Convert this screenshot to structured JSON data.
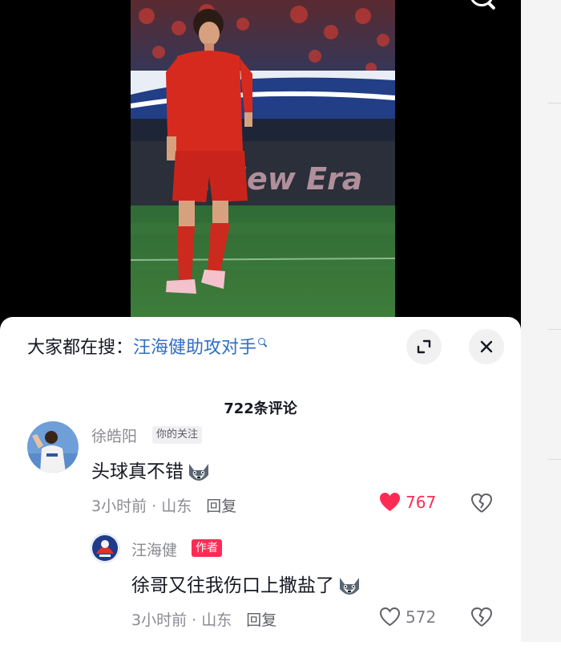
{
  "video": {
    "board_text": "A New Era"
  },
  "sheet": {
    "trend_prefix": "大家都在搜：",
    "trend_keyword": "汪海健助攻对手",
    "comment_count": "722条评论"
  },
  "comments": [
    {
      "username": "徐皓阳",
      "badge": "你的关注",
      "text": "头球真不错",
      "time_location": "3小时前 · 山东",
      "reply_label": "回复",
      "likes": "767",
      "liked": true
    },
    {
      "username": "汪海健",
      "badge": "作者",
      "text": "徐哥又往我伤口上撒盐了",
      "time_location": "3小时前 · 山东",
      "reply_label": "回复",
      "likes": "572",
      "liked": false
    }
  ],
  "icons": {
    "trend_search": "search-icon",
    "expand": "expand-icon",
    "close": "close-icon",
    "like": "heart-icon",
    "dislike": "broken-heart-icon",
    "emoji": "husky-emoji-icon"
  },
  "colors": {
    "accent": "#fe2c55",
    "link": "#2f6fc4",
    "muted": "#8a8b91"
  }
}
